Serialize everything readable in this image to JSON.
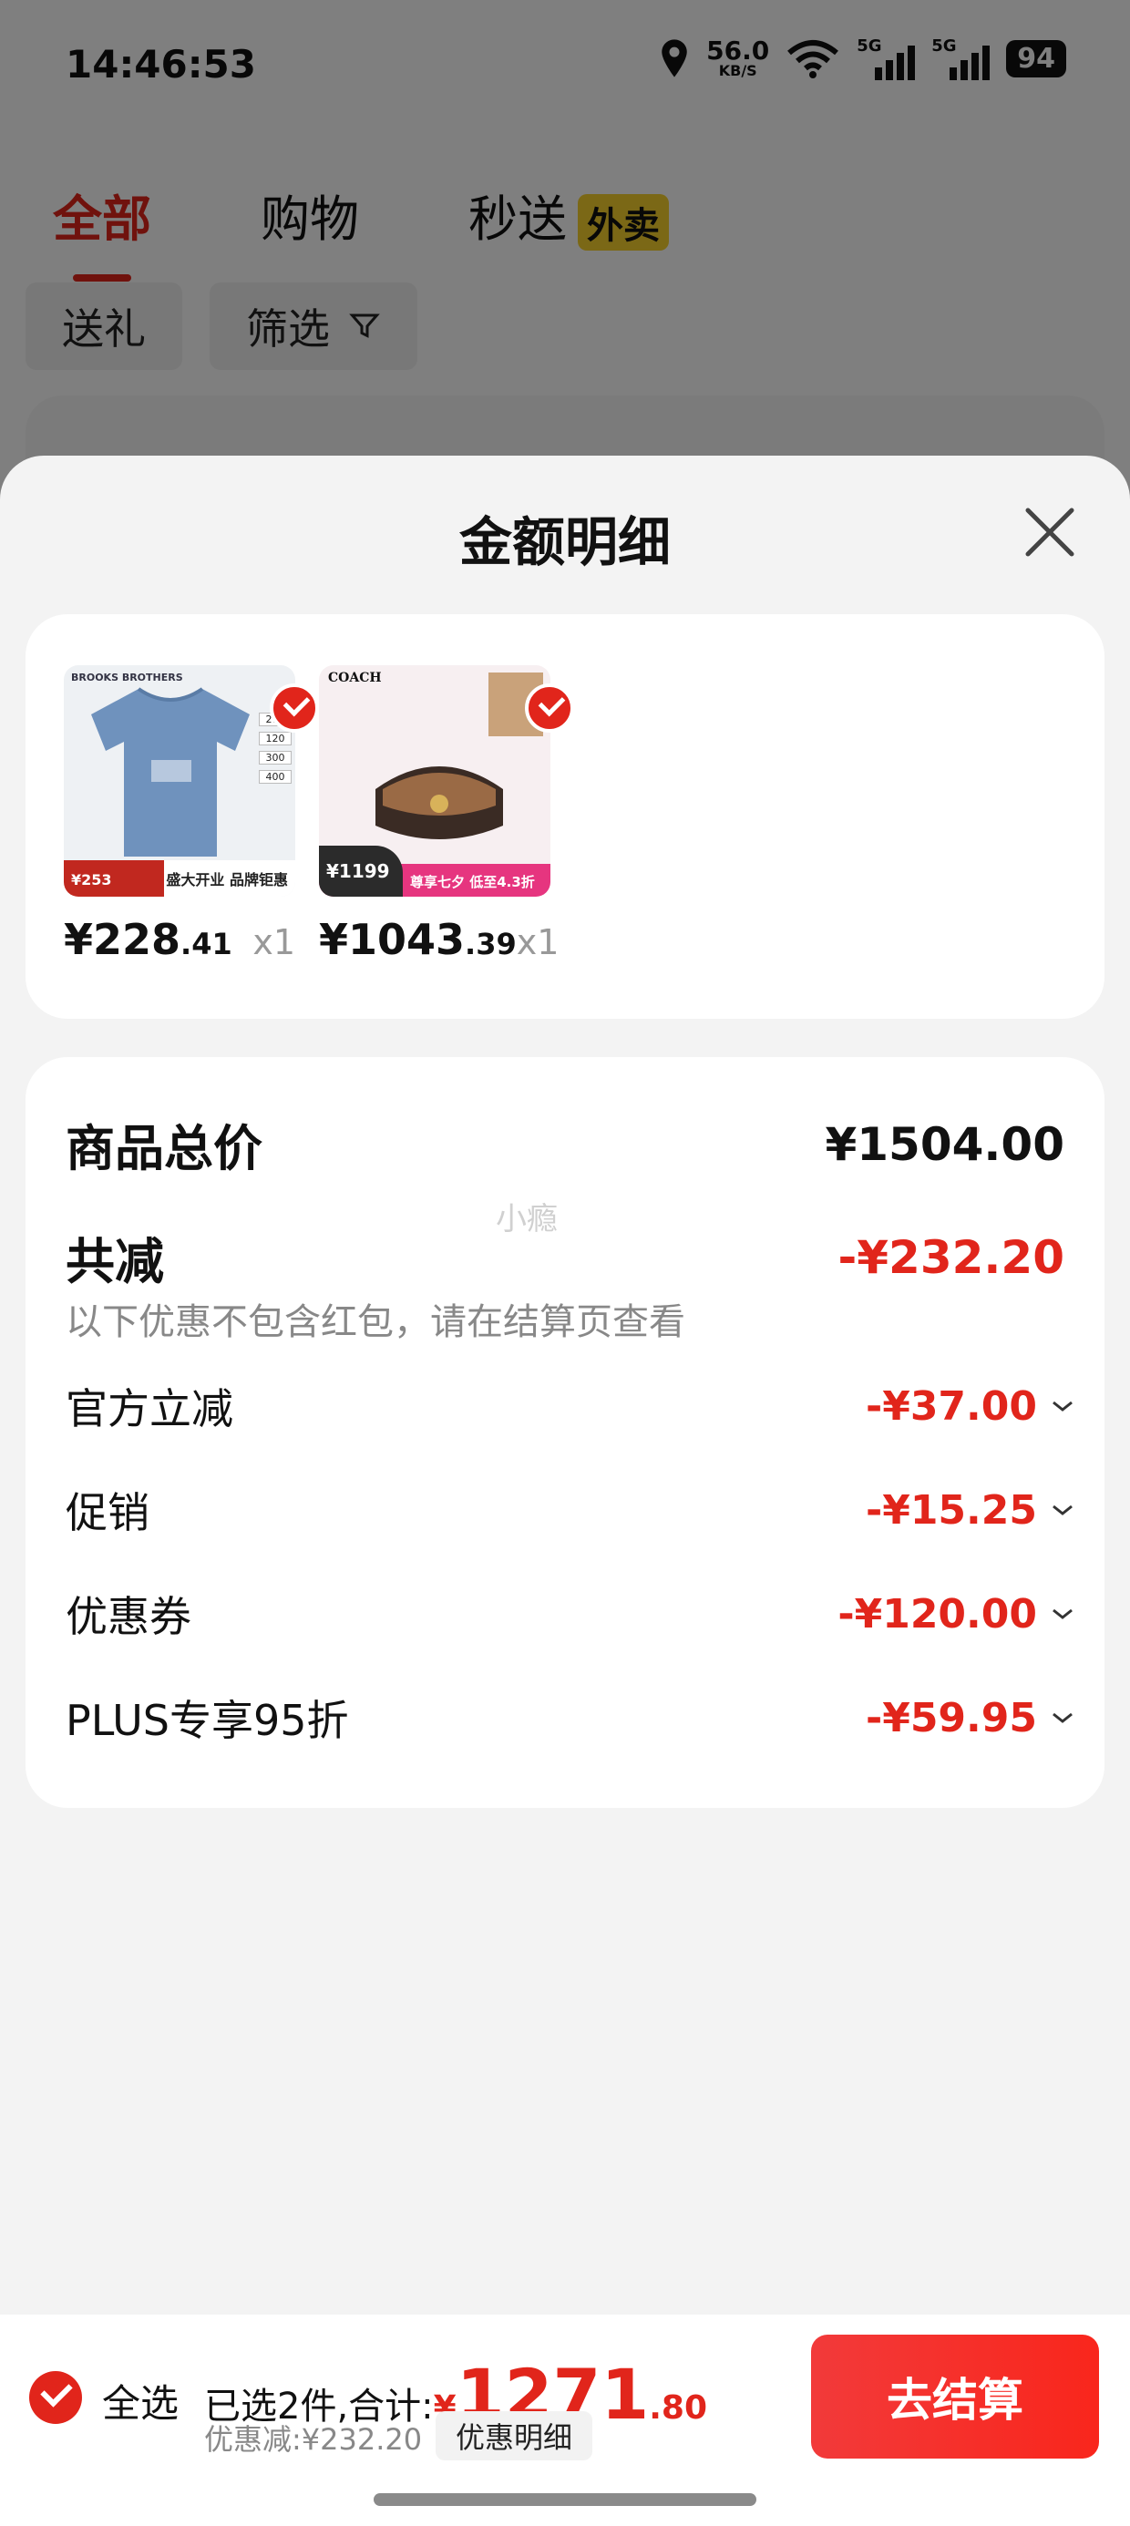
{
  "status_bar": {
    "time": "14:46:53",
    "speed_value": "56.0",
    "speed_unit": "KB/S",
    "sig1_tag": "5G",
    "sig2_tag": "5G",
    "battery": "94"
  },
  "tabs": [
    {
      "label": "全部"
    },
    {
      "label": "购物"
    },
    {
      "label": "秒送",
      "badge": "外卖"
    }
  ],
  "filters": {
    "gift": "送礼",
    "filter": "筛选"
  },
  "sheet": {
    "title": "金额明细"
  },
  "goods": [
    {
      "price_int": "¥228",
      "price_dec": ".41",
      "qty": "x1",
      "image": {
        "brand": "BROOKS BROTHERS",
        "tag_price": "¥253",
        "slogan": "盛大开业 品牌钜惠"
      }
    },
    {
      "price_int": "¥1043",
      "price_dec": ".39",
      "qty": "x1",
      "image": {
        "brand": "COACH",
        "tag_price": "¥1199",
        "slogan": "尊享七夕 低至4.3折"
      }
    }
  ],
  "summary": {
    "total_label": "商品总价",
    "total_value": "¥1504.00",
    "reduce_label": "共减",
    "reduce_value": "-¥232.20",
    "note": "以下优惠不包含红包，请在结算页查看",
    "watermark": "小瘾",
    "items": [
      {
        "label": "官方立减",
        "value": "-¥37.00"
      },
      {
        "label": "促销",
        "value": "-¥15.25"
      },
      {
        "label": "优惠券",
        "value": "-¥120.00"
      },
      {
        "label": "PLUS专享95折",
        "value": "-¥59.95"
      }
    ]
  },
  "bottom_bar": {
    "select_all": "全选",
    "selected_text": "已选2件,合计:",
    "currency": "¥",
    "total_int": "1271",
    "total_dec": ".80",
    "discount_text": "优惠减:¥232.20",
    "detail_button": "优惠明细",
    "checkout_button": "去结算"
  },
  "colors": {
    "accent": "#e1251b",
    "badge": "#f6d12c"
  },
  "icons": {
    "location": "location-icon",
    "wifi": "wifi-icon",
    "filter": "filter-icon",
    "close": "close-icon",
    "check": "check-icon",
    "chevron": "chevron-down-icon"
  }
}
